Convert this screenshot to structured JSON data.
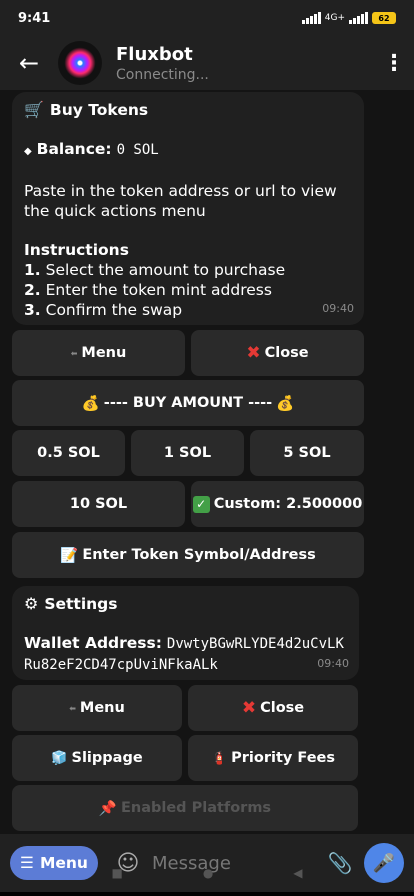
{
  "status": {
    "time": "9:41",
    "network": "4G+",
    "battery": "62"
  },
  "header": {
    "title": "Fluxbot",
    "subtitle": "Connecting..."
  },
  "buy_message": {
    "title": "Buy Tokens",
    "balance_label": "Balance:",
    "balance_value": "0 SOL",
    "paste_text": "Paste in the token address or url to view the quick actions menu",
    "instructions_title": "Instructions",
    "steps": [
      {
        "num": "1.",
        "text": "Select the amount to purchase"
      },
      {
        "num": "2.",
        "text": "Enter the token mint address"
      },
      {
        "num": "3.",
        "text": "Confirm the swap"
      }
    ],
    "time": "09:40"
  },
  "buy_keyboard": {
    "menu": "Menu",
    "close": "Close",
    "buy_amount": "---- BUY AMOUNT ----",
    "amounts": [
      "0.5 SOL",
      "1 SOL",
      "5 SOL",
      "10 SOL"
    ],
    "custom": "Custom: 2.500000",
    "enter_token": "Enter Token Symbol/Address"
  },
  "settings_message": {
    "title": "Settings",
    "wallet_label": "Wallet Address:",
    "wallet_value": "DvwtyBGwRLYDE4d2uCvLKRu82eF2CD47cpUviNFkaALk",
    "time": "09:40"
  },
  "settings_keyboard": {
    "menu": "Menu",
    "close": "Close",
    "slippage": "Slippage",
    "priority_fees": "Priority Fees",
    "enabled_platforms": "Enabled Platforms"
  },
  "input": {
    "menu_label": "Menu",
    "placeholder": "Message"
  }
}
